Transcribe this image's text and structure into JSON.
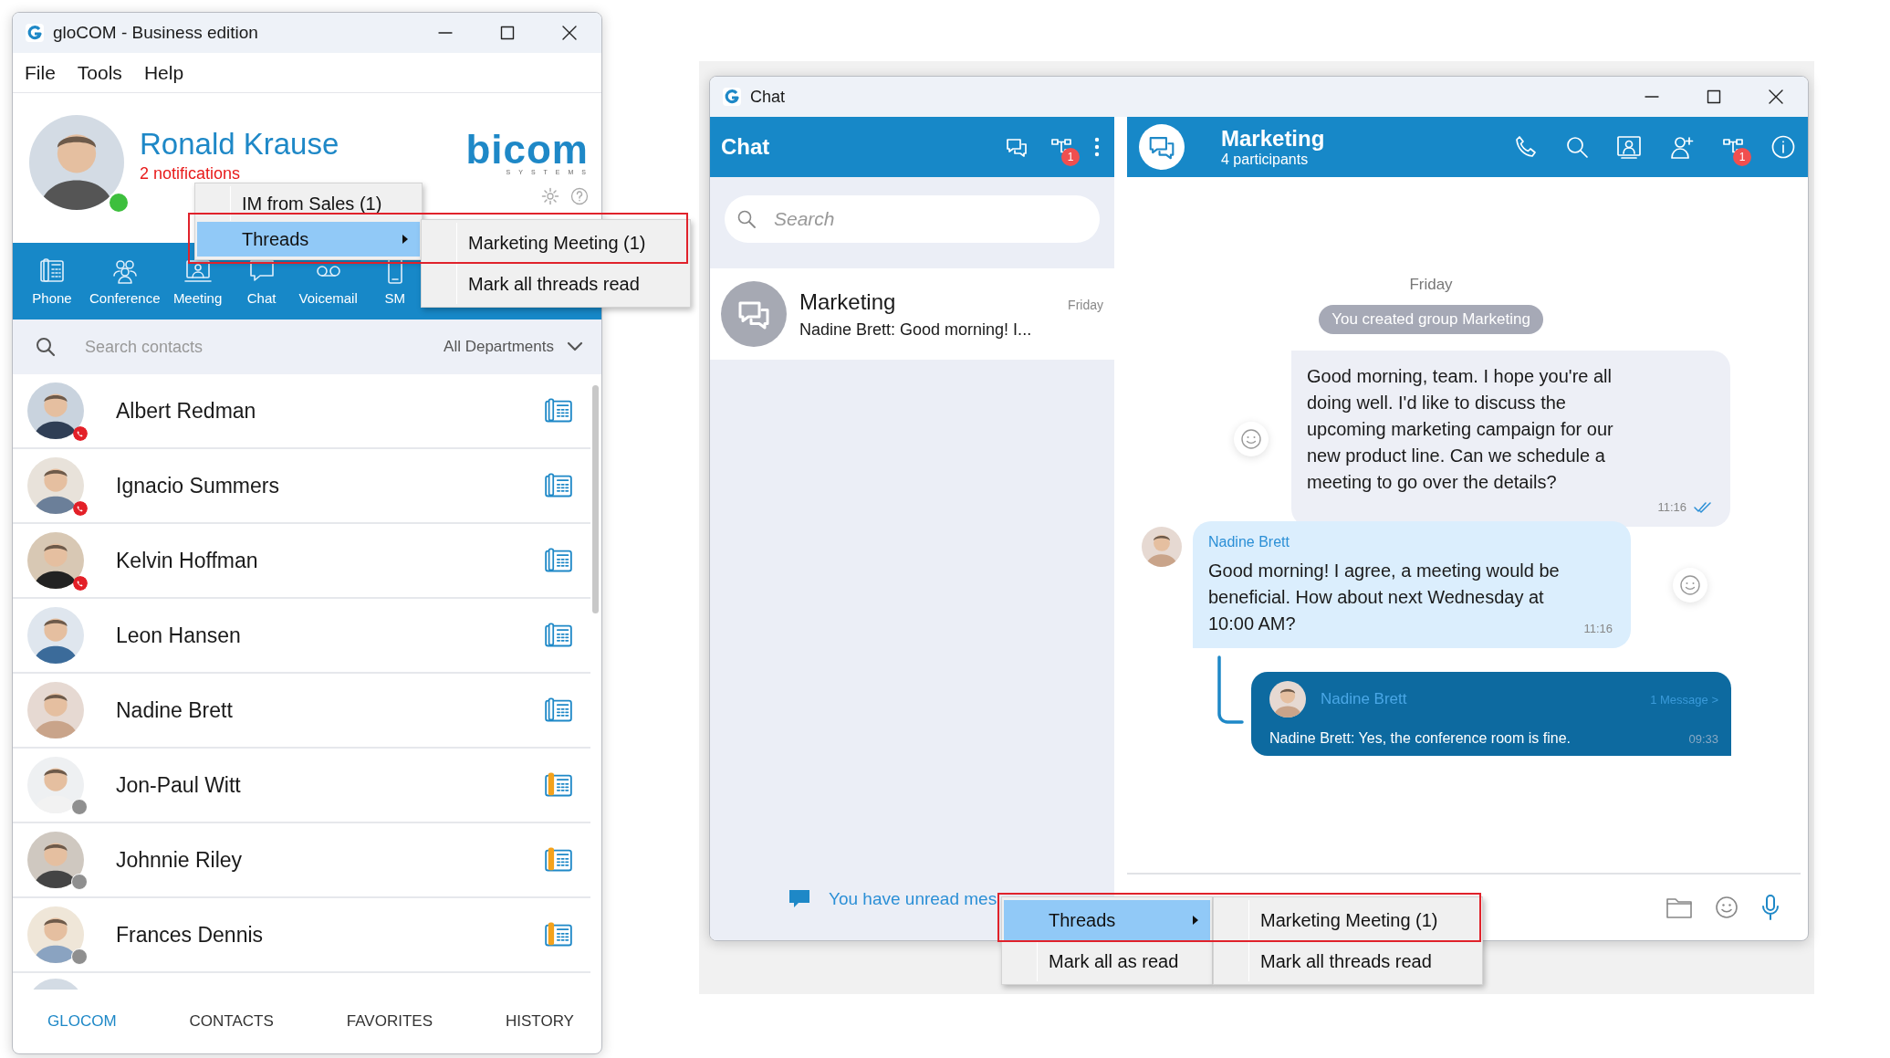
{
  "glocom": {
    "title": "gloCOM - Business edition",
    "menu": [
      "File",
      "Tools",
      "Help"
    ],
    "profile": {
      "name": "Ronald Krause",
      "notifications": "2 notifications",
      "online": true
    },
    "logo": {
      "word": "bicom",
      "sub": "SYSTEMS"
    },
    "toolbar": [
      {
        "label": "Phone"
      },
      {
        "label": "Conference"
      },
      {
        "label": "Meeting"
      },
      {
        "label": "Chat"
      },
      {
        "label": "Voicemail"
      },
      {
        "label": "SM"
      }
    ],
    "search": {
      "placeholder": "Search contacts",
      "department": "All Departments"
    },
    "contacts": [
      {
        "name": "Albert Redman",
        "kind": "busy"
      },
      {
        "name": "Ignacio Summers",
        "kind": "busy"
      },
      {
        "name": "Kelvin Hoffman",
        "kind": "busy"
      },
      {
        "name": "Leon Hansen",
        "kind": "available"
      },
      {
        "name": "Nadine Brett",
        "kind": "available"
      },
      {
        "name": "Jon-Paul Witt",
        "kind": "offline"
      },
      {
        "name": "Johnnie Riley",
        "kind": "offline"
      },
      {
        "name": "Frances Dennis",
        "kind": "offline"
      }
    ],
    "bottom_tabs": [
      {
        "label": "GLOCOM",
        "selected": true
      },
      {
        "label": "CONTACTS",
        "selected": false
      },
      {
        "label": "FAVORITES",
        "selected": false
      },
      {
        "label": "HISTORY",
        "selected": false
      }
    ],
    "context_menu": {
      "items": [
        {
          "label": "IM from Sales (1)",
          "selected": false,
          "submenu": false
        },
        {
          "label": "Threads",
          "selected": true,
          "submenu": true
        }
      ],
      "submenu": [
        {
          "label": "Marketing Meeting (1)"
        },
        {
          "label": "Mark all threads read"
        }
      ]
    }
  },
  "chat": {
    "title": "Chat",
    "panel_title": "Chat",
    "panel_badge": "1",
    "search": {
      "placeholder": "Search"
    },
    "conversations": [
      {
        "name": "Marketing",
        "time": "Friday",
        "preview": "Nadine Brett: Good morning! I..."
      }
    ],
    "unread_notice": "You have unread mes",
    "header": {
      "name": "Marketing",
      "subtitle": "4 participants",
      "badge": "1"
    },
    "messages": [
      {
        "kind": "date",
        "text": "Friday"
      },
      {
        "kind": "system",
        "text": "You created group Marketing"
      },
      {
        "kind": "outgoing",
        "text": "Good morning, team. I hope you're all doing well. I'd like to discuss the upcoming marketing campaign for our new product line. Can we schedule a meeting to go over the details?",
        "time": "11:16",
        "read": true
      },
      {
        "kind": "incoming",
        "sender": "Nadine Brett",
        "text": "Good morning! I agree, a meeting would be beneficial. How about next Wednesday at 10:00 AM?",
        "time": "11:16"
      },
      {
        "kind": "thread",
        "sender": "Nadine Brett",
        "count": "1 Message >",
        "text": "Nadine Brett: Yes, the conference room is fine.",
        "time": "09:33"
      }
    ],
    "context_menu": {
      "items": [
        {
          "label": "Threads",
          "selected": true,
          "submenu": true
        },
        {
          "label": "Mark all as read",
          "selected": false,
          "submenu": false
        }
      ],
      "submenu": [
        {
          "label": "Marketing Meeting (1)"
        },
        {
          "label": "Mark all threads read"
        }
      ]
    }
  }
}
